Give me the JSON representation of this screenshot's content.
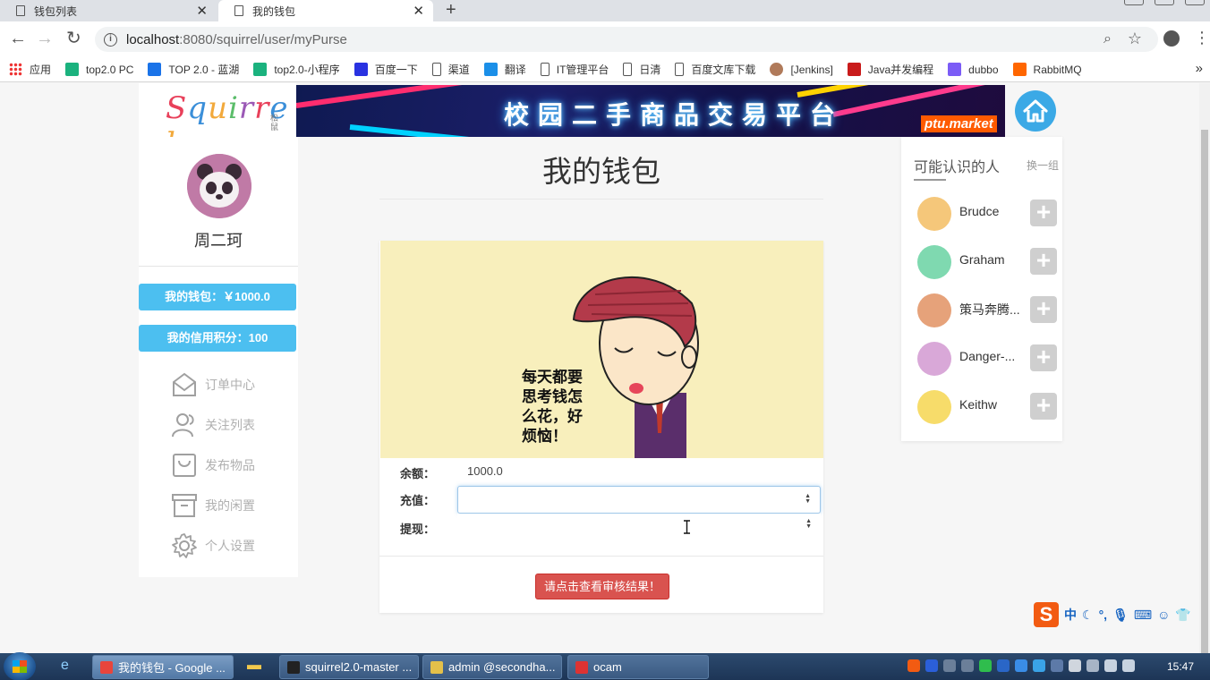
{
  "browser": {
    "tabs": [
      {
        "title": "钱包列表",
        "active": false
      },
      {
        "title": "我的钱包",
        "active": true
      }
    ],
    "new_tab": "+",
    "address": {
      "host": "localhost",
      "port": ":8080",
      "path": "/squirrel/user/myPurse"
    },
    "bookmarks": [
      {
        "label": "应用",
        "icon": "apps-grid-icon",
        "color": "#e33"
      },
      {
        "label": "top2.0 PC",
        "icon": "bookmark-icon",
        "color": "#1bb27e"
      },
      {
        "label": "TOP 2.0 - 蓝湖",
        "icon": "lanhu-icon",
        "color": "#1a73e8"
      },
      {
        "label": "top2.0-小程序",
        "icon": "bookmark-icon",
        "color": "#1bb27e"
      },
      {
        "label": "百度一下",
        "icon": "baidu-paw-icon",
        "color": "#2932e1"
      },
      {
        "label": "渠道",
        "icon": "doc-icon",
        "color": "#fff"
      },
      {
        "label": "翻译",
        "icon": "translate-icon",
        "color": "#1b8fe8"
      },
      {
        "label": "IT管理平台",
        "icon": "doc-icon",
        "color": "#fff"
      },
      {
        "label": "日清",
        "icon": "doc-icon",
        "color": "#fff"
      },
      {
        "label": "百度文库下载",
        "icon": "doc-icon",
        "color": "#fff"
      },
      {
        "label": "[Jenkins]",
        "icon": "jenkins-icon",
        "color": "#b07a5a"
      },
      {
        "label": "Java并发编程",
        "icon": "c-icon",
        "color": "#c91b1b"
      },
      {
        "label": "dubbo",
        "icon": "dubbo-icon",
        "color": "#7b5cf6"
      },
      {
        "label": "RabbitMQ",
        "icon": "rabbitmq-icon",
        "color": "#f60"
      }
    ]
  },
  "header": {
    "logo_text": "Squirrel",
    "logo_sub": "松鼠",
    "banner_text": "校园二手商品交易平台",
    "banner_tag": "ptu.market"
  },
  "user": {
    "name": "周二珂",
    "wallet_button": "我的钱包：￥1000.0",
    "credit_button": "我的信用积分：100"
  },
  "sidebar": {
    "items": [
      {
        "label": "订单中心",
        "icon": "order-envelope-icon"
      },
      {
        "label": "关注列表",
        "icon": "users-icon"
      },
      {
        "label": "发布物品",
        "icon": "bag-icon"
      },
      {
        "label": "我的闲置",
        "icon": "archive-box-icon"
      },
      {
        "label": "个人设置",
        "icon": "gear-icon"
      }
    ]
  },
  "main": {
    "title": "我的钱包",
    "illustration_caption": "每天都要思考钱怎么花，好烦恼！",
    "form": {
      "balance_label": "余额：",
      "balance_value": "1000.0",
      "recharge_label": "充值：",
      "recharge_value": "",
      "withdraw_label": "提现：",
      "withdraw_value": ""
    },
    "result_button": "请点击查看审核结果！"
  },
  "people": {
    "title": "可能认识的人",
    "switch": "换一组",
    "list": [
      {
        "name": "Brudce",
        "avatar_color": "#f5c77a",
        "icon": "owl-avatar-icon"
      },
      {
        "name": "Graham",
        "avatar_color": "#7fd9b0",
        "icon": "pug-avatar-icon"
      },
      {
        "name": "策马奔腾...",
        "avatar_color": "#e6a27a",
        "icon": "lion-avatar-icon"
      },
      {
        "name": "Danger-...",
        "avatar_color": "#d9a8d8",
        "icon": "koala-avatar-icon"
      },
      {
        "name": "Keithw",
        "avatar_color": "#f7dc6a",
        "icon": "cat-avatar-icon"
      }
    ],
    "add_label": "+"
  },
  "ime": {
    "mode": "中"
  },
  "taskbar": {
    "tasks": [
      {
        "label": "我的钱包 - Google ...",
        "icon_color": "#e8453c",
        "active": true
      },
      {
        "label": "squirrel2.0-master ...",
        "icon_color": "#222",
        "active": false
      },
      {
        "label": "admin @secondha...",
        "icon_color": "#e3c04a",
        "active": false
      },
      {
        "label": "ocam",
        "icon_color": "#d33",
        "active": false
      }
    ],
    "clock": "15:47"
  }
}
